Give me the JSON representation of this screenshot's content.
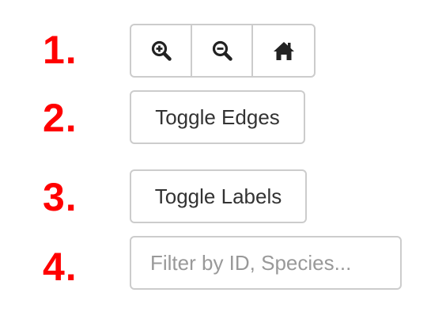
{
  "steps": [
    "1.",
    "2.",
    "3.",
    "4."
  ],
  "zoom_controls": {
    "zoom_in_icon": "zoom-in-icon",
    "zoom_out_icon": "zoom-out-icon",
    "home_icon": "home-icon"
  },
  "toggle_edges": {
    "label": "Toggle Edges"
  },
  "toggle_labels": {
    "label": "Toggle Labels"
  },
  "filter": {
    "placeholder": "Filter by ID, Species...",
    "value": ""
  },
  "colors": {
    "step_number": "#ff0000",
    "border": "#cccccc",
    "text": "#333333",
    "placeholder": "#999999"
  }
}
